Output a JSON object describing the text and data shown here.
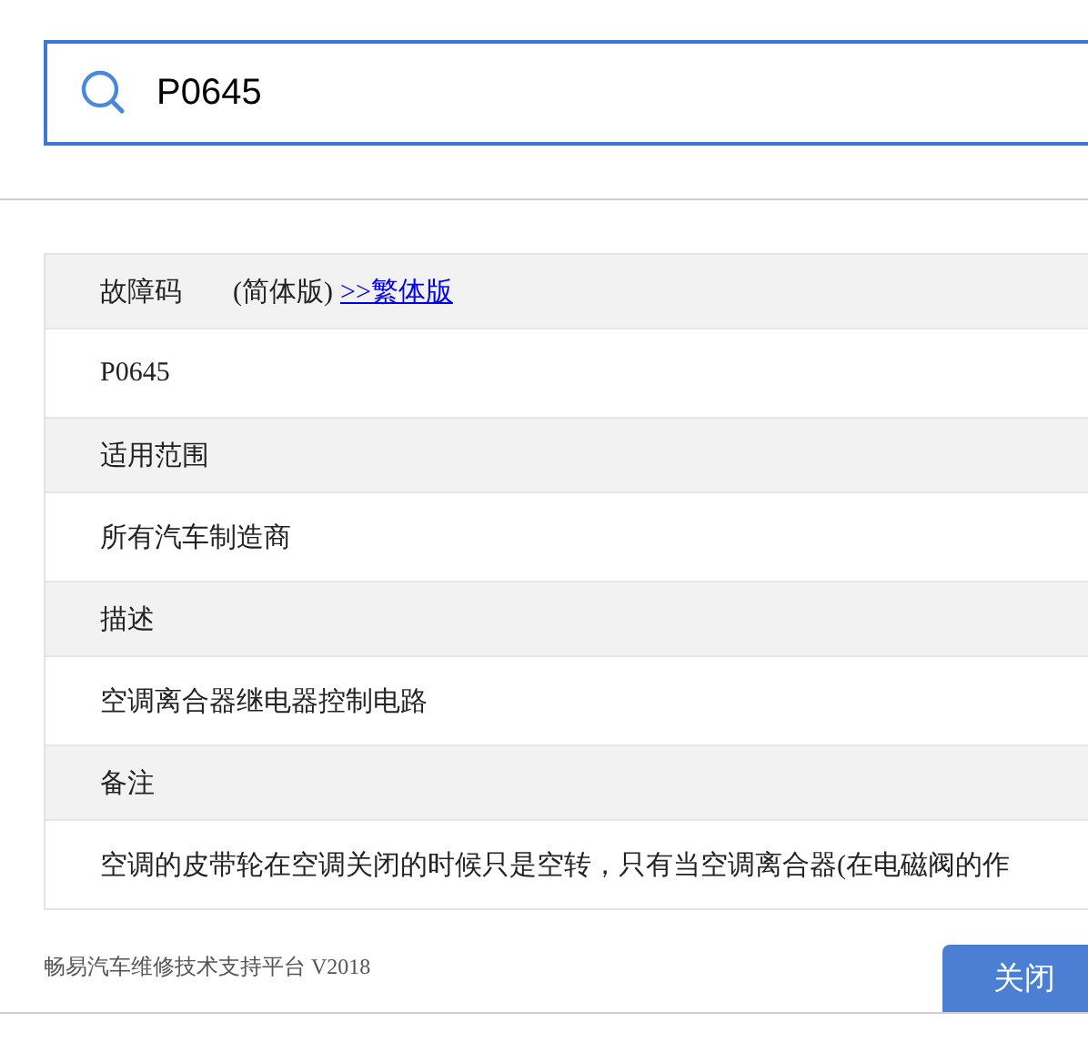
{
  "search": {
    "value": "P0645"
  },
  "table": {
    "rows": [
      {
        "kind": "heading",
        "label": "故障码",
        "note": "(简体版)",
        "link": ">>繁体版"
      },
      {
        "kind": "value",
        "text": "P0645"
      },
      {
        "kind": "heading",
        "label": "适用范围"
      },
      {
        "kind": "value",
        "text": "所有汽车制造商"
      },
      {
        "kind": "heading",
        "label": "描述"
      },
      {
        "kind": "value",
        "text": "空调离合器继电器控制电路"
      },
      {
        "kind": "heading",
        "label": "备注"
      },
      {
        "kind": "value",
        "text": "空调的皮带轮在空调关闭的时候只是空转，只有当空调离合器(在电磁阀的作"
      }
    ]
  },
  "footer": {
    "text": "畅易汽车维修技术支持平台 V2018",
    "button": "关闭"
  }
}
